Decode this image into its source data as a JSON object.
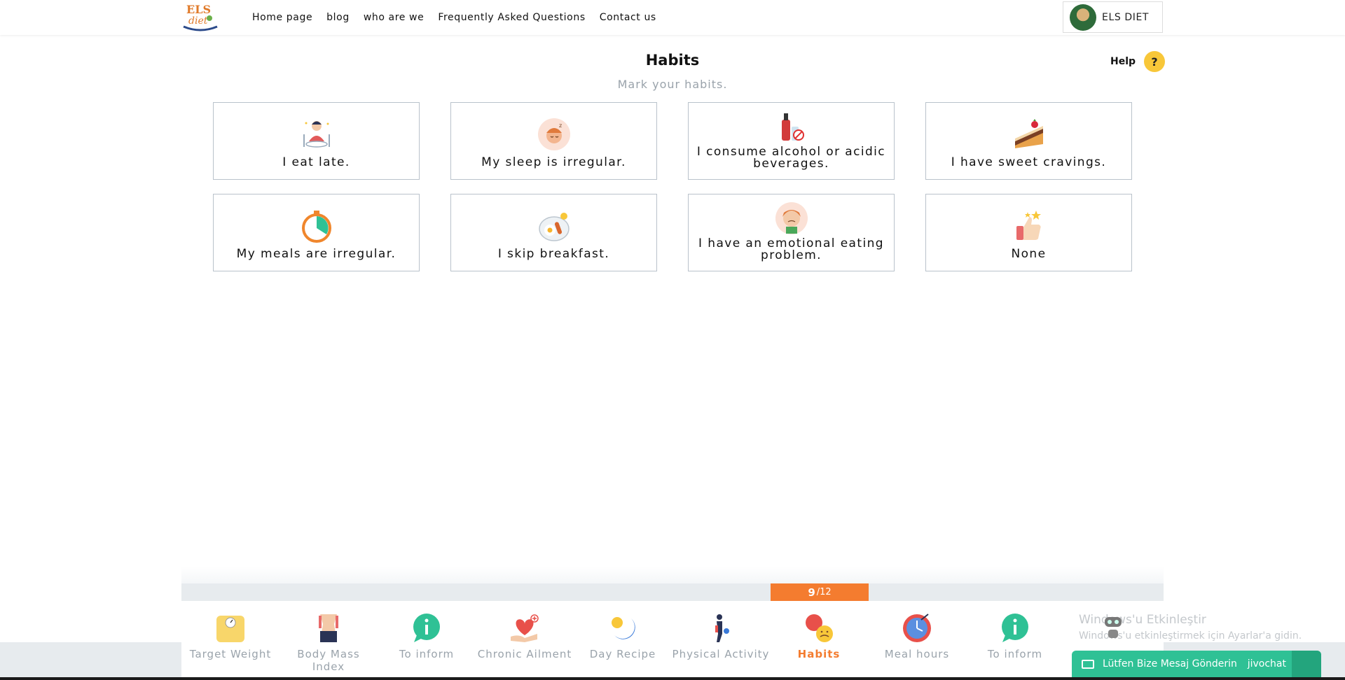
{
  "header": {
    "nav": [
      "Home page",
      "blog",
      "who are we",
      "Frequently Asked Questions",
      "Contact us"
    ],
    "profile_name": "ELS DIET",
    "logo_text": "ELS diet"
  },
  "page": {
    "title": "Habits",
    "subtitle": "Mark your habits.",
    "help_label": "Help",
    "help_symbol": "?"
  },
  "habits": [
    {
      "label": "I eat late.",
      "icon": "eating-person-icon"
    },
    {
      "label": "My sleep is irregular.",
      "icon": "sleeping-face-icon"
    },
    {
      "label": "I consume alcohol or acidic beverages.",
      "icon": "bottle-no-icon"
    },
    {
      "label": "I have sweet cravings.",
      "icon": "cake-slice-icon"
    },
    {
      "label": "My meals are irregular.",
      "icon": "stopwatch-icon"
    },
    {
      "label": "I skip breakfast.",
      "icon": "breakfast-plate-icon"
    },
    {
      "label": "I have an emotional eating problem.",
      "icon": "emotional-face-icon"
    },
    {
      "label": "None",
      "icon": "thumbs-up-stars-icon"
    }
  ],
  "progress": {
    "current": "9",
    "total": "/12"
  },
  "steps": [
    {
      "label": "Target Weight",
      "icon": "scale-icon"
    },
    {
      "label": "Body Mass Index",
      "icon": "body-waist-icon"
    },
    {
      "label": "To inform",
      "icon": "info-bubble-icon"
    },
    {
      "label": "Chronic Ailment",
      "icon": "heart-hand-icon"
    },
    {
      "label": "Day Recipe",
      "icon": "sun-moon-icon"
    },
    {
      "label": "Physical Activity",
      "icon": "exercise-person-icon"
    },
    {
      "label": "Habits",
      "icon": "emotions-icon",
      "active": true
    },
    {
      "label": "Meal hours",
      "icon": "clock-icon"
    },
    {
      "label": "To inform",
      "icon": "info-bubble-icon"
    }
  ],
  "watermark": {
    "line1": "Windows'u Etkinleştir",
    "line2": "Windows'u etkinleştirmek için Ayarlar'a gidin."
  },
  "chat": {
    "label": "Lütfen Bize Mesaj Gönderin",
    "brand": "jivochat"
  },
  "colors": {
    "accent": "#f47c2f",
    "chat": "#2fc195",
    "help": "#f8c739",
    "muted": "#9aa3ab"
  }
}
